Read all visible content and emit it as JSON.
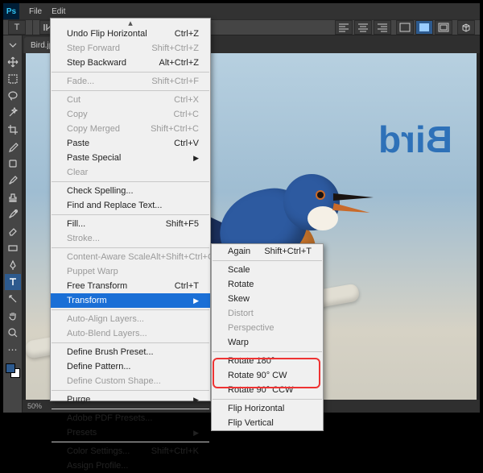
{
  "menubar": {
    "items": [
      "File",
      "Edit"
    ]
  },
  "ps_badge": "Ps",
  "doctab": {
    "name": "Bird.jpg",
    "close": "×"
  },
  "canvas_text": "Bird",
  "zoom": "50%",
  "optbar": {
    "tool_letter": "T"
  },
  "edit_menu": {
    "groups": [
      [
        {
          "label": "Undo Flip Horizontal",
          "shortcut": "Ctrl+Z"
        },
        {
          "label": "Step Forward",
          "shortcut": "Shift+Ctrl+Z",
          "disabled": true
        },
        {
          "label": "Step Backward",
          "shortcut": "Alt+Ctrl+Z"
        }
      ],
      [
        {
          "label": "Fade...",
          "shortcut": "Shift+Ctrl+F",
          "disabled": true
        }
      ],
      [
        {
          "label": "Cut",
          "shortcut": "Ctrl+X",
          "disabled": true
        },
        {
          "label": "Copy",
          "shortcut": "Ctrl+C",
          "disabled": true
        },
        {
          "label": "Copy Merged",
          "shortcut": "Shift+Ctrl+C",
          "disabled": true
        },
        {
          "label": "Paste",
          "shortcut": "Ctrl+V"
        },
        {
          "label": "Paste Special",
          "submenu": true
        },
        {
          "label": "Clear",
          "disabled": true
        }
      ],
      [
        {
          "label": "Check Spelling..."
        },
        {
          "label": "Find and Replace Text..."
        }
      ],
      [
        {
          "label": "Fill...",
          "shortcut": "Shift+F5"
        },
        {
          "label": "Stroke...",
          "disabled": true
        }
      ],
      [
        {
          "label": "Content-Aware Scale",
          "shortcut": "Alt+Shift+Ctrl+C",
          "disabled": true
        },
        {
          "label": "Puppet Warp",
          "disabled": true
        },
        {
          "label": "Free Transform",
          "shortcut": "Ctrl+T"
        },
        {
          "label": "Transform",
          "submenu": true,
          "highlight": true
        }
      ],
      [
        {
          "label": "Auto-Align Layers...",
          "disabled": true
        },
        {
          "label": "Auto-Blend Layers...",
          "disabled": true
        }
      ],
      [
        {
          "label": "Define Brush Preset..."
        },
        {
          "label": "Define Pattern..."
        },
        {
          "label": "Define Custom Shape...",
          "disabled": true
        }
      ],
      [
        {
          "label": "Purge",
          "submenu": true
        }
      ],
      [
        {
          "label": "Adobe PDF Presets..."
        },
        {
          "label": "Presets",
          "submenu": true
        }
      ],
      [
        {
          "label": "Color Settings...",
          "shortcut": "Shift+Ctrl+K"
        },
        {
          "label": "Assign Profile..."
        }
      ]
    ]
  },
  "transform_submenu": {
    "groups": [
      [
        {
          "label": "Again",
          "shortcut": "Shift+Ctrl+T"
        }
      ],
      [
        {
          "label": "Scale"
        },
        {
          "label": "Rotate"
        },
        {
          "label": "Skew"
        },
        {
          "label": "Distort",
          "disabled": true
        },
        {
          "label": "Perspective",
          "disabled": true
        },
        {
          "label": "Warp"
        }
      ],
      [
        {
          "label": "Rotate 180°"
        },
        {
          "label": "Rotate 90° CW"
        },
        {
          "label": "Rotate 90° CCW"
        }
      ],
      [
        {
          "label": "Flip Horizontal"
        },
        {
          "label": "Flip Vertical"
        }
      ]
    ]
  }
}
